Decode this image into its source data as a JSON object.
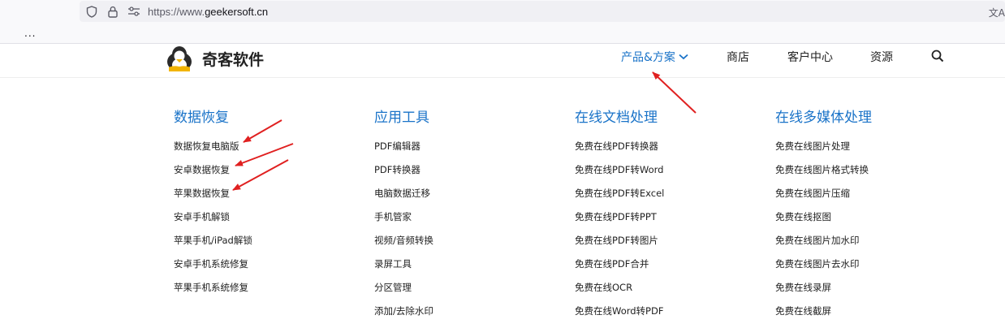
{
  "browser": {
    "url_prefix": "https://www.",
    "url_domain": "geekersoft.cn",
    "tabs_overflow": "..."
  },
  "header": {
    "brand": "奇客软件",
    "nav": {
      "products": "产品&方案",
      "store": "商店",
      "customer_center": "客户中心",
      "resources": "资源"
    }
  },
  "menu": {
    "columns": [
      {
        "title": "数据恢复",
        "items": [
          "数据恢复电脑版",
          "安卓数据恢复",
          "苹果数据恢复",
          "安卓手机解锁",
          "苹果手机/iPad解锁",
          "安卓手机系统修复",
          "苹果手机系统修复"
        ]
      },
      {
        "title": "应用工具",
        "items": [
          "PDF编辑器",
          "PDF转换器",
          "电脑数据迁移",
          "手机管家",
          "视频/音频转换",
          "录屏工具",
          "分区管理",
          "添加/去除水印"
        ]
      },
      {
        "title": "在线文档处理",
        "items": [
          "免费在线PDF转换器",
          "免费在线PDF转Word",
          "免费在线PDF转Excel",
          "免费在线PDF转PPT",
          "免费在线PDF转图片",
          "免费在线PDF合并",
          "免费在线OCR",
          "免费在线Word转PDF"
        ]
      },
      {
        "title": "在线多媒体处理",
        "items": [
          "免费在线图片处理",
          "免费在线图片格式转换",
          "免费在线图片压缩",
          "免费在线抠图",
          "免费在线图片加水印",
          "免费在线图片去水印",
          "免费在线录屏",
          "免费在线截屏"
        ]
      }
    ]
  },
  "colors": {
    "accent": "#1a73c8",
    "annotation_arrow": "#e02020"
  }
}
